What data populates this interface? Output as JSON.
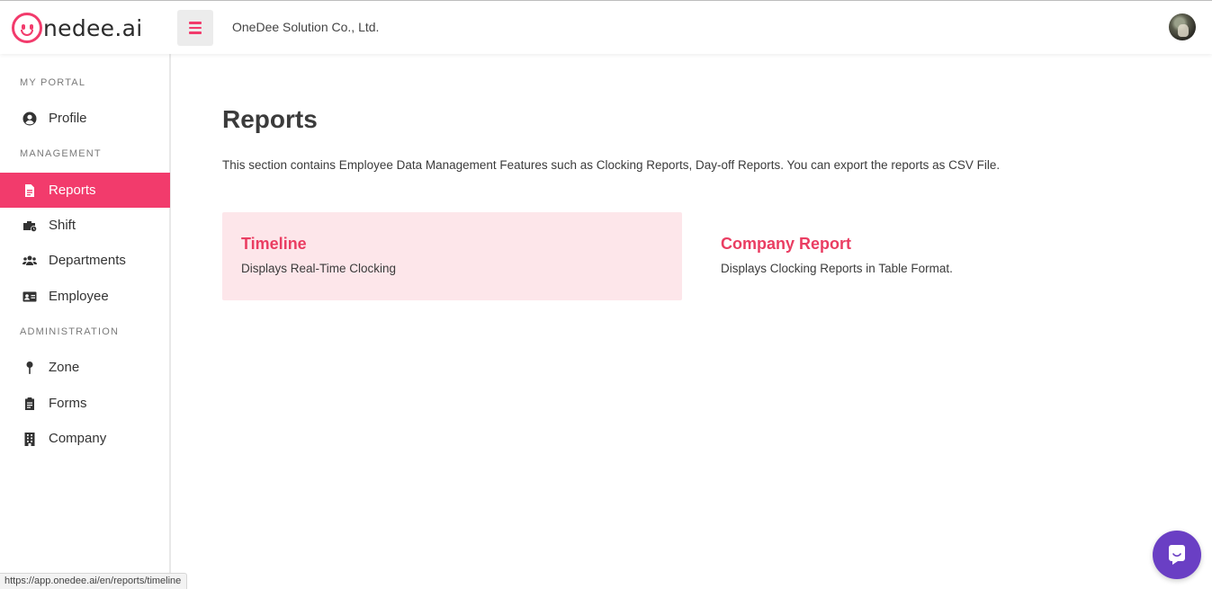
{
  "header": {
    "logo_text": "nedee.ai",
    "company_name": "OneDee Solution Co., Ltd."
  },
  "sidebar": {
    "sections": [
      {
        "label": "MY PORTAL",
        "items": [
          {
            "label": "Profile",
            "icon": "user-circle-icon",
            "active": false
          }
        ]
      },
      {
        "label": "MANAGEMENT",
        "items": [
          {
            "label": "Reports",
            "icon": "file-icon",
            "active": true
          },
          {
            "label": "Shift",
            "icon": "briefcase-clock-icon",
            "active": false
          },
          {
            "label": "Departments",
            "icon": "users-icon",
            "active": false
          },
          {
            "label": "Employee",
            "icon": "id-card-icon",
            "active": false
          }
        ]
      },
      {
        "label": "ADMINISTRATION",
        "items": [
          {
            "label": "Zone",
            "icon": "map-pin-icon",
            "active": false
          },
          {
            "label": "Forms",
            "icon": "clipboard-icon",
            "active": false
          },
          {
            "label": "Company",
            "icon": "building-icon",
            "active": false
          }
        ]
      }
    ]
  },
  "main": {
    "title": "Reports",
    "description": "This section contains Employee Data Management Features such as Clocking Reports, Day-off Reports. You can export the reports as CSV File.",
    "cards": [
      {
        "title": "Timeline",
        "description": "Displays Real-Time Clocking",
        "highlighted": true
      },
      {
        "title": "Company Report",
        "description": "Displays Clocking Reports in Table Format.",
        "highlighted": false
      }
    ]
  },
  "status_bar": {
    "url": "https://app.onedee.ai/en/reports/timeline"
  },
  "colors": {
    "accent": "#f23b6c",
    "card_highlight": "#fde6ea",
    "chat": "#6a3fc4"
  }
}
